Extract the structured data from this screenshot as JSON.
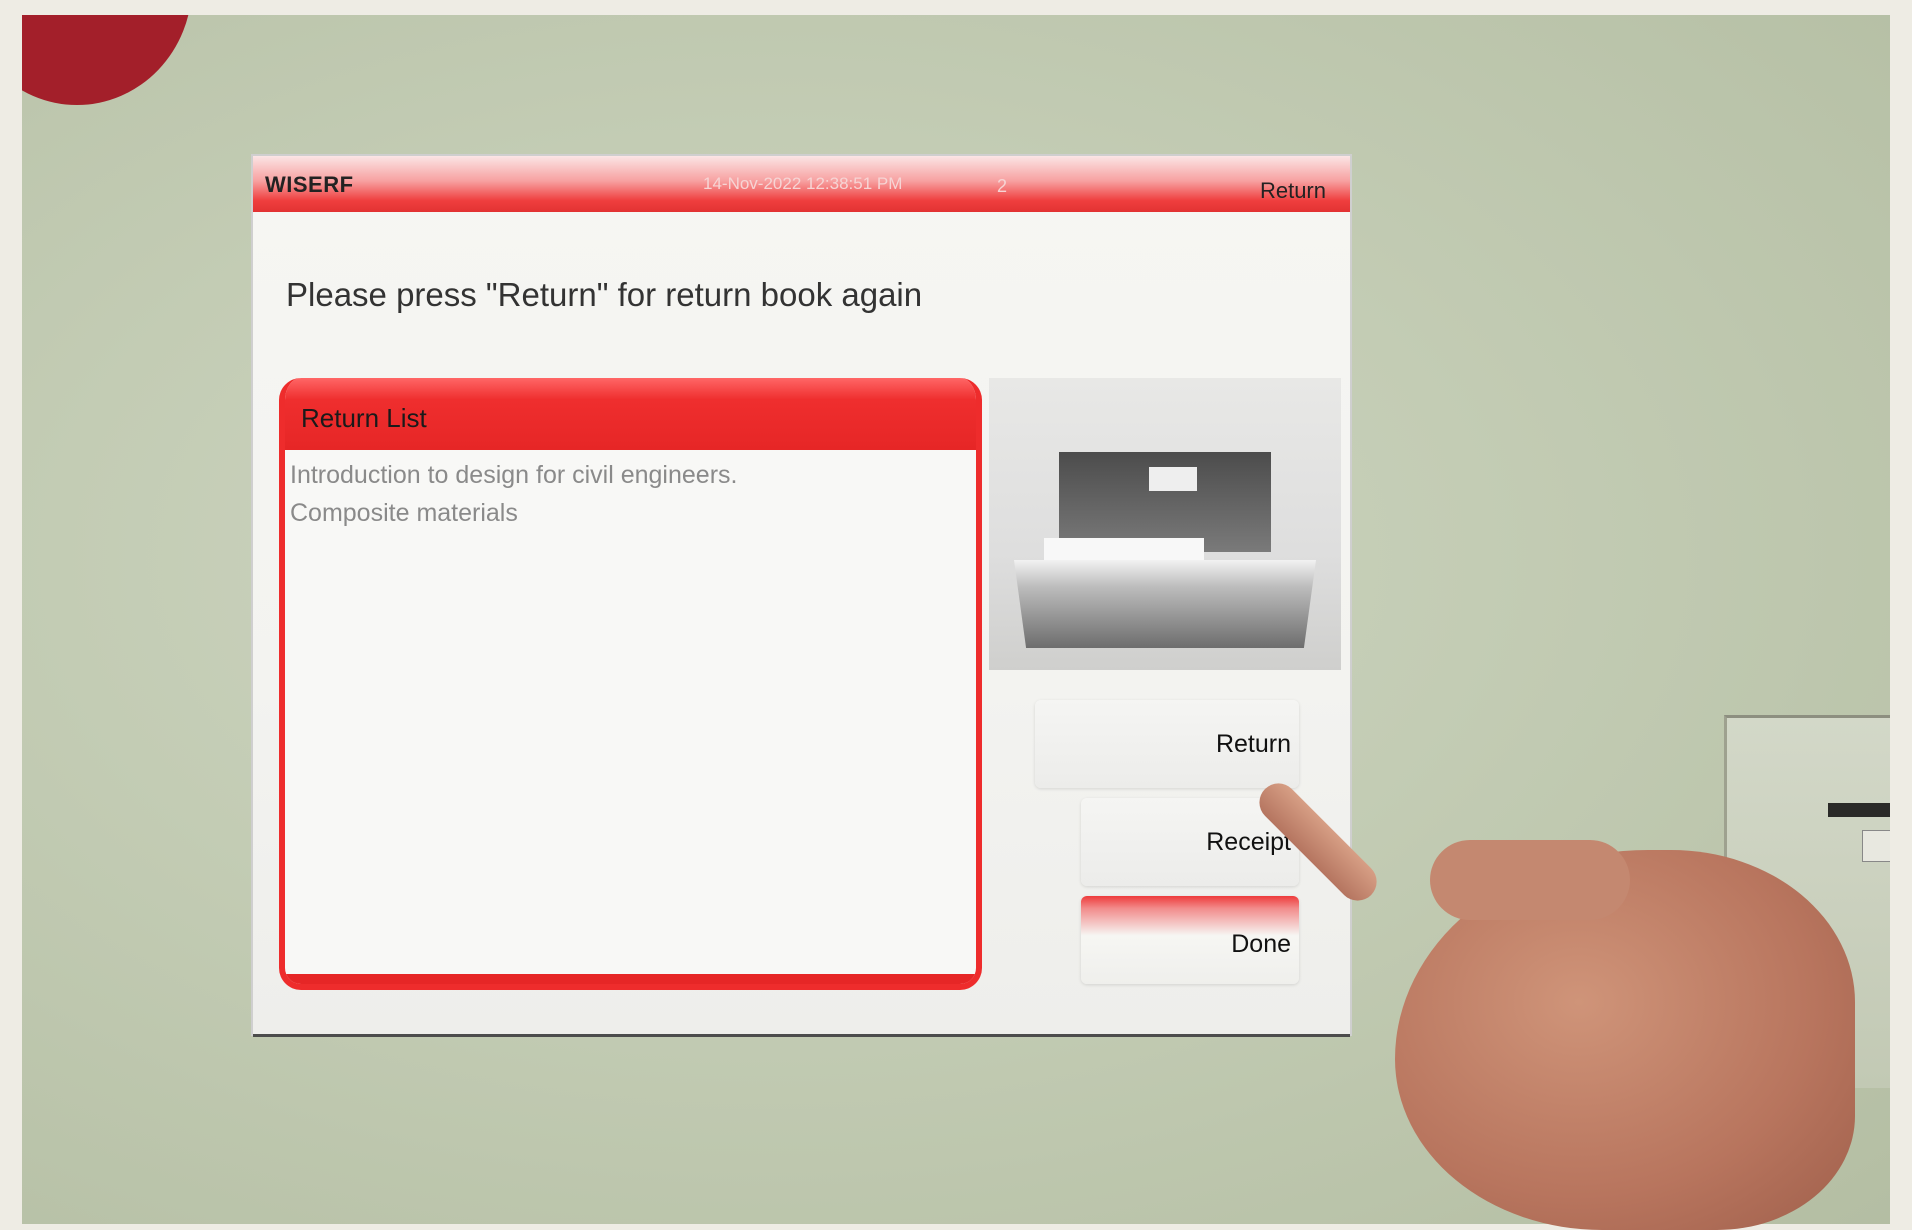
{
  "kiosk": {
    "brand": "WISERF",
    "datetime": "14-Nov-2022 12:38:51 PM",
    "bar_number": "2",
    "mode": "Return",
    "instruction": "Please press \"Return\" for return book again",
    "return_list": {
      "title": "Return List",
      "items": [
        "Introduction to design for civil engineers.",
        "Composite materials"
      ]
    },
    "buttons": {
      "return_label": "Return",
      "receipt_label": "Receipt",
      "done_label": "Done"
    }
  },
  "colors": {
    "accent_red": "#e62626",
    "badge_red": "#a31f2a",
    "screen_bg": "#f5f5f2",
    "wall": "#c3ccb4"
  }
}
